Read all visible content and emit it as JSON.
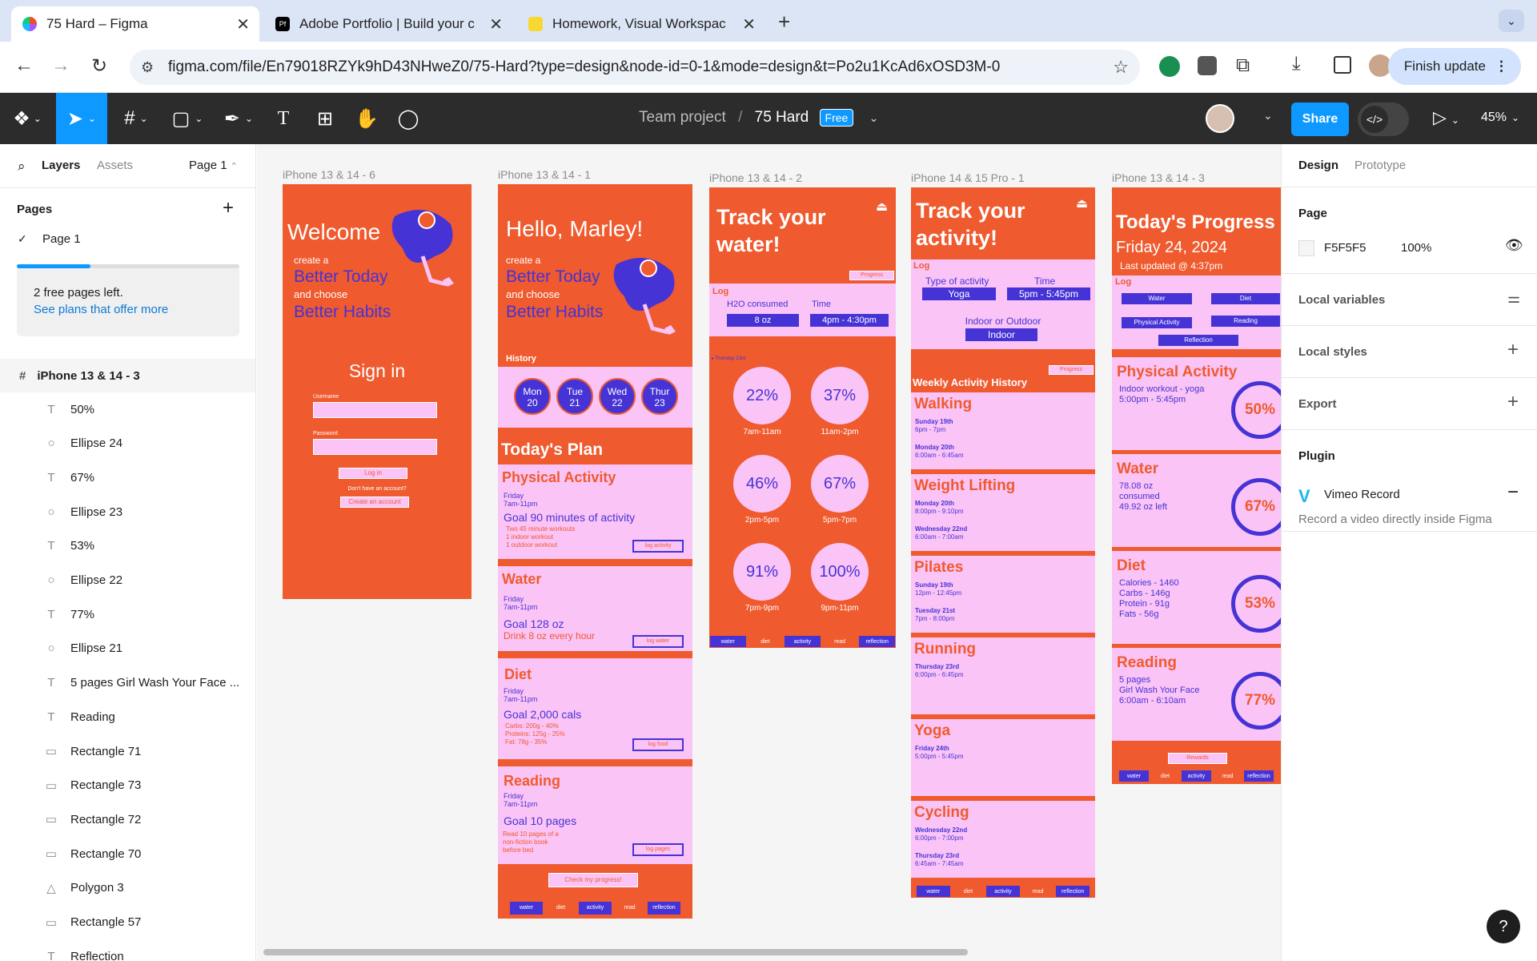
{
  "browser": {
    "tabs": [
      {
        "label": "75 Hard – Figma"
      },
      {
        "label": "Adobe Portfolio | Build your c"
      },
      {
        "label": "Homework, Visual Workspac"
      }
    ],
    "new_tab": "+",
    "url": "figma.com/file/En79018RZYk9hD43NHweZ0/75-Hard?type=design&node-id=0-1&mode=design&t=Po2u1KcAd6xOSD3M-0",
    "finish_update": "Finish update"
  },
  "toolbar": {
    "project": "Team project",
    "separator": "/",
    "file_name": "75 Hard",
    "plan_badge": "Free",
    "share": "Share",
    "zoom": "45%"
  },
  "left_panel": {
    "tabs": [
      "Layers",
      "Assets"
    ],
    "page_selector": "Page 1",
    "pages_title": "Pages",
    "pages": [
      "Page 1"
    ],
    "free_pages_text": "2 free pages left.",
    "plans_link": "See plans that offer more",
    "free_pages_fraction": 0.33,
    "frame_name": "iPhone 13 & 14 - 3",
    "layers": [
      {
        "type": "text",
        "name": "50%"
      },
      {
        "type": "ellipse",
        "name": "Ellipse 24"
      },
      {
        "type": "text",
        "name": "67%"
      },
      {
        "type": "ellipse",
        "name": "Ellipse 23"
      },
      {
        "type": "text",
        "name": "53%"
      },
      {
        "type": "ellipse",
        "name": "Ellipse 22"
      },
      {
        "type": "text",
        "name": "77%"
      },
      {
        "type": "ellipse",
        "name": "Ellipse 21"
      },
      {
        "type": "text",
        "name": "5 pages Girl Wash Your Face ..."
      },
      {
        "type": "text",
        "name": "Reading"
      },
      {
        "type": "rect",
        "name": "Rectangle 71"
      },
      {
        "type": "rect",
        "name": "Rectangle 73"
      },
      {
        "type": "rect",
        "name": "Rectangle 72"
      },
      {
        "type": "rect",
        "name": "Rectangle 70"
      },
      {
        "type": "polygon",
        "name": "Polygon 3"
      },
      {
        "type": "rect",
        "name": "Rectangle 57"
      },
      {
        "type": "text",
        "name": "Reflection"
      }
    ]
  },
  "right_panel": {
    "tabs": [
      "Design",
      "Prototype"
    ],
    "page_section": "Page",
    "bg_color": "F5F5F5",
    "opacity": "100%",
    "local_variables": "Local variables",
    "local_styles": "Local styles",
    "export": "Export",
    "plugin_section": "Plugin",
    "plugin_name": "Vimeo Record",
    "plugin_desc": "Record a video directly inside Figma"
  },
  "frames": {
    "f6": {
      "label": "iPhone 13 & 14 - 6",
      "welcome": "Welcome",
      "create": "create a",
      "better_today": "Better Today",
      "and_choose": "and choose",
      "better_habits": "Better Habits",
      "sign_in": "Sign in",
      "username": "Username",
      "password": "Password",
      "login": "Log in",
      "no_account": "Don't have an account?",
      "create_account": "Create an account"
    },
    "f1": {
      "label": "iPhone 13 & 14 - 1",
      "hello": "Hello, Marley!",
      "create": "create a",
      "better_today": "Better Today",
      "and_choose": "and choose",
      "better_habits": "Better Habits",
      "history": "History",
      "days": [
        {
          "d": "Mon",
          "n": "20"
        },
        {
          "d": "Tue",
          "n": "21"
        },
        {
          "d": "Wed",
          "n": "22"
        },
        {
          "d": "Thur",
          "n": "23"
        }
      ],
      "todays_plan": "Today's Plan",
      "pa_title": "Physical Activity",
      "pa_day": "Friday",
      "pa_time": "7am-11pm",
      "pa_goal": "Goal 90 minutes of activity",
      "pa_d1": "Two 45 minute workouts",
      "pa_d2": "1 indoor workout",
      "pa_d3": "1 outdoor workout",
      "pa_btn": "log activity",
      "w_title": "Water",
      "w_day": "Friday",
      "w_time": "7am-11pm",
      "w_goal": "Goal 128 oz",
      "w_d1": "Drink 8 oz every hour",
      "w_btn": "log water",
      "d_title": "Diet",
      "d_day": "Friday",
      "d_time": "7am-11pm",
      "d_goal": "Goal 2,000 cals",
      "d_d1": "Carbs: 200g - 40%",
      "d_d2": "Proteins: 125g - 25%",
      "d_d3": "Fat: 78g - 35%",
      "d_btn": "log food",
      "r_title": "Reading",
      "r_day": "Friday",
      "r_time": "7am-11pm",
      "r_goal": "Goal 10 pages",
      "r_d1": "Read 10 pages of a",
      "r_d2": "non-fiction book",
      "r_d3": "before bed",
      "r_btn": "log pages",
      "progress_btn": "Check my progress!",
      "nav": [
        "water",
        "diet",
        "activity",
        "read",
        "reflection"
      ]
    },
    "f2": {
      "label": "iPhone 13 & 14 - 2",
      "title1": "Track your",
      "title2": "water!",
      "progress": "Progress",
      "log": "Log",
      "h2o": "H2O consumed",
      "time": "Time",
      "oz": "8 oz",
      "slot": "4pm - 4:30pm",
      "day": "Thursday 23rd",
      "circles": [
        {
          "p": "22%",
          "t": "7am-11am"
        },
        {
          "p": "37%",
          "t": "11am-2pm"
        },
        {
          "p": "46%",
          "t": "2pm-5pm"
        },
        {
          "p": "67%",
          "t": "5pm-7pm"
        },
        {
          "p": "91%",
          "t": "7pm-9pm"
        },
        {
          "p": "100%",
          "t": "9pm-11pm"
        }
      ],
      "nav": [
        "water",
        "diet",
        "activity",
        "read",
        "reflection"
      ]
    },
    "f15": {
      "label": "iPhone 14 & 15 Pro - 1",
      "title1": "Track your",
      "title2": "activity!",
      "log": "Log",
      "type_label": "Type of activity",
      "time_label": "Time",
      "type_val": "Yoga",
      "time_val": "5pm - 5:45pm",
      "io_label": "Indoor or Outdoor",
      "io_val": "Indoor",
      "progress": "Progress",
      "weekly": "Weekly Activity History",
      "acts": [
        {
          "t": "Walking",
          "l1": "Sunday 19th",
          "l2": "6pm - 7pm",
          "l3": "Monday 20th",
          "l4": "6:00am - 6:45am"
        },
        {
          "t": "Weight Lifting",
          "l1": "Monday 20th",
          "l2": "8:00pm - 9:10pm",
          "l3": "Wednesday 22nd",
          "l4": "6:00am - 7:00am"
        },
        {
          "t": "Pilates",
          "l1": "Sunday 19th",
          "l2": "12pm - 12:45pm",
          "l3": "Tuesday 21st",
          "l4": "7pm - 8:00pm"
        },
        {
          "t": "Running",
          "l1": "Thursday 23rd",
          "l2": "6:00pm - 6:45pm",
          "l3": "",
          "l4": ""
        },
        {
          "t": "Yoga",
          "l1": "Friday 24th",
          "l2": "5:00pm - 5:45pm",
          "l3": "",
          "l4": ""
        },
        {
          "t": "Cycling",
          "l1": "Wednesday 22nd",
          "l2": "6:00pm - 7:00pm",
          "l3": "Thursday 23rd",
          "l4": "6:45am - 7:45am"
        }
      ],
      "nav": [
        "water",
        "diet",
        "activity",
        "read",
        "reflection"
      ]
    },
    "f3": {
      "label": "iPhone 13 & 14 - 3",
      "title": "Today's Progress",
      "date": "Friday 24, 2024",
      "updated": "Last updated @ 4:37pm",
      "log": "Log",
      "chips": [
        "Water",
        "Diet",
        "Physical Activity",
        "Reading",
        "Reflection"
      ],
      "items": [
        {
          "t": "Physical Activity",
          "l1": "Indoor workout - yoga",
          "l2": "5:00pm - 5:45pm",
          "l3": "",
          "l4": "",
          "p": "50%"
        },
        {
          "t": "Water",
          "l1": "78.08 oz",
          "l2": "consumed",
          "l3": "49.92 oz left",
          "l4": "",
          "p": "67%"
        },
        {
          "t": "Diet",
          "l1": "Calories - 1460",
          "l2": "Carbs - 146g",
          "l3": "Protein - 91g",
          "l4": "Fats - 56g",
          "p": "53%"
        },
        {
          "t": "Reading",
          "l1": "5 pages",
          "l2": "Girl Wash Your Face",
          "l3": "6:00am - 6:10am",
          "l4": "",
          "p": "77%"
        }
      ],
      "rewards": "Rewards",
      "nav": [
        "water",
        "diet",
        "activity",
        "read",
        "reflection"
      ]
    }
  }
}
